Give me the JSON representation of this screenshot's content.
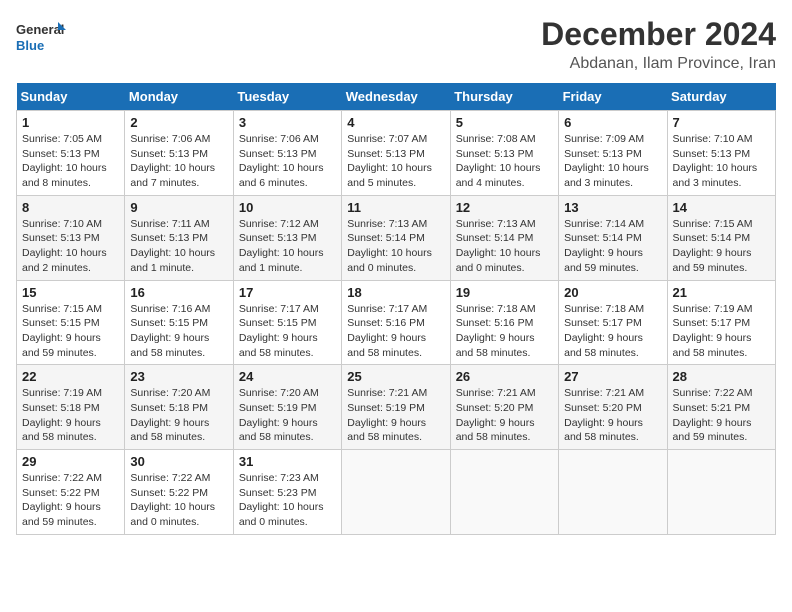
{
  "logo": {
    "line1": "General",
    "line2": "Blue"
  },
  "title": "December 2024",
  "location": "Abdanan, Ilam Province, Iran",
  "days_of_week": [
    "Sunday",
    "Monday",
    "Tuesday",
    "Wednesday",
    "Thursday",
    "Friday",
    "Saturday"
  ],
  "weeks": [
    [
      {
        "day": 1,
        "info": "Sunrise: 7:05 AM\nSunset: 5:13 PM\nDaylight: 10 hours\nand 8 minutes."
      },
      {
        "day": 2,
        "info": "Sunrise: 7:06 AM\nSunset: 5:13 PM\nDaylight: 10 hours\nand 7 minutes."
      },
      {
        "day": 3,
        "info": "Sunrise: 7:06 AM\nSunset: 5:13 PM\nDaylight: 10 hours\nand 6 minutes."
      },
      {
        "day": 4,
        "info": "Sunrise: 7:07 AM\nSunset: 5:13 PM\nDaylight: 10 hours\nand 5 minutes."
      },
      {
        "day": 5,
        "info": "Sunrise: 7:08 AM\nSunset: 5:13 PM\nDaylight: 10 hours\nand 4 minutes."
      },
      {
        "day": 6,
        "info": "Sunrise: 7:09 AM\nSunset: 5:13 PM\nDaylight: 10 hours\nand 3 minutes."
      },
      {
        "day": 7,
        "info": "Sunrise: 7:10 AM\nSunset: 5:13 PM\nDaylight: 10 hours\nand 3 minutes."
      }
    ],
    [
      {
        "day": 8,
        "info": "Sunrise: 7:10 AM\nSunset: 5:13 PM\nDaylight: 10 hours\nand 2 minutes."
      },
      {
        "day": 9,
        "info": "Sunrise: 7:11 AM\nSunset: 5:13 PM\nDaylight: 10 hours\nand 1 minute."
      },
      {
        "day": 10,
        "info": "Sunrise: 7:12 AM\nSunset: 5:13 PM\nDaylight: 10 hours\nand 1 minute."
      },
      {
        "day": 11,
        "info": "Sunrise: 7:13 AM\nSunset: 5:14 PM\nDaylight: 10 hours\nand 0 minutes."
      },
      {
        "day": 12,
        "info": "Sunrise: 7:13 AM\nSunset: 5:14 PM\nDaylight: 10 hours\nand 0 minutes."
      },
      {
        "day": 13,
        "info": "Sunrise: 7:14 AM\nSunset: 5:14 PM\nDaylight: 9 hours\nand 59 minutes."
      },
      {
        "day": 14,
        "info": "Sunrise: 7:15 AM\nSunset: 5:14 PM\nDaylight: 9 hours\nand 59 minutes."
      }
    ],
    [
      {
        "day": 15,
        "info": "Sunrise: 7:15 AM\nSunset: 5:15 PM\nDaylight: 9 hours\nand 59 minutes."
      },
      {
        "day": 16,
        "info": "Sunrise: 7:16 AM\nSunset: 5:15 PM\nDaylight: 9 hours\nand 58 minutes."
      },
      {
        "day": 17,
        "info": "Sunrise: 7:17 AM\nSunset: 5:15 PM\nDaylight: 9 hours\nand 58 minutes."
      },
      {
        "day": 18,
        "info": "Sunrise: 7:17 AM\nSunset: 5:16 PM\nDaylight: 9 hours\nand 58 minutes."
      },
      {
        "day": 19,
        "info": "Sunrise: 7:18 AM\nSunset: 5:16 PM\nDaylight: 9 hours\nand 58 minutes."
      },
      {
        "day": 20,
        "info": "Sunrise: 7:18 AM\nSunset: 5:17 PM\nDaylight: 9 hours\nand 58 minutes."
      },
      {
        "day": 21,
        "info": "Sunrise: 7:19 AM\nSunset: 5:17 PM\nDaylight: 9 hours\nand 58 minutes."
      }
    ],
    [
      {
        "day": 22,
        "info": "Sunrise: 7:19 AM\nSunset: 5:18 PM\nDaylight: 9 hours\nand 58 minutes."
      },
      {
        "day": 23,
        "info": "Sunrise: 7:20 AM\nSunset: 5:18 PM\nDaylight: 9 hours\nand 58 minutes."
      },
      {
        "day": 24,
        "info": "Sunrise: 7:20 AM\nSunset: 5:19 PM\nDaylight: 9 hours\nand 58 minutes."
      },
      {
        "day": 25,
        "info": "Sunrise: 7:21 AM\nSunset: 5:19 PM\nDaylight: 9 hours\nand 58 minutes."
      },
      {
        "day": 26,
        "info": "Sunrise: 7:21 AM\nSunset: 5:20 PM\nDaylight: 9 hours\nand 58 minutes."
      },
      {
        "day": 27,
        "info": "Sunrise: 7:21 AM\nSunset: 5:20 PM\nDaylight: 9 hours\nand 58 minutes."
      },
      {
        "day": 28,
        "info": "Sunrise: 7:22 AM\nSunset: 5:21 PM\nDaylight: 9 hours\nand 59 minutes."
      }
    ],
    [
      {
        "day": 29,
        "info": "Sunrise: 7:22 AM\nSunset: 5:22 PM\nDaylight: 9 hours\nand 59 minutes."
      },
      {
        "day": 30,
        "info": "Sunrise: 7:22 AM\nSunset: 5:22 PM\nDaylight: 10 hours\nand 0 minutes."
      },
      {
        "day": 31,
        "info": "Sunrise: 7:23 AM\nSunset: 5:23 PM\nDaylight: 10 hours\nand 0 minutes."
      },
      null,
      null,
      null,
      null
    ]
  ]
}
